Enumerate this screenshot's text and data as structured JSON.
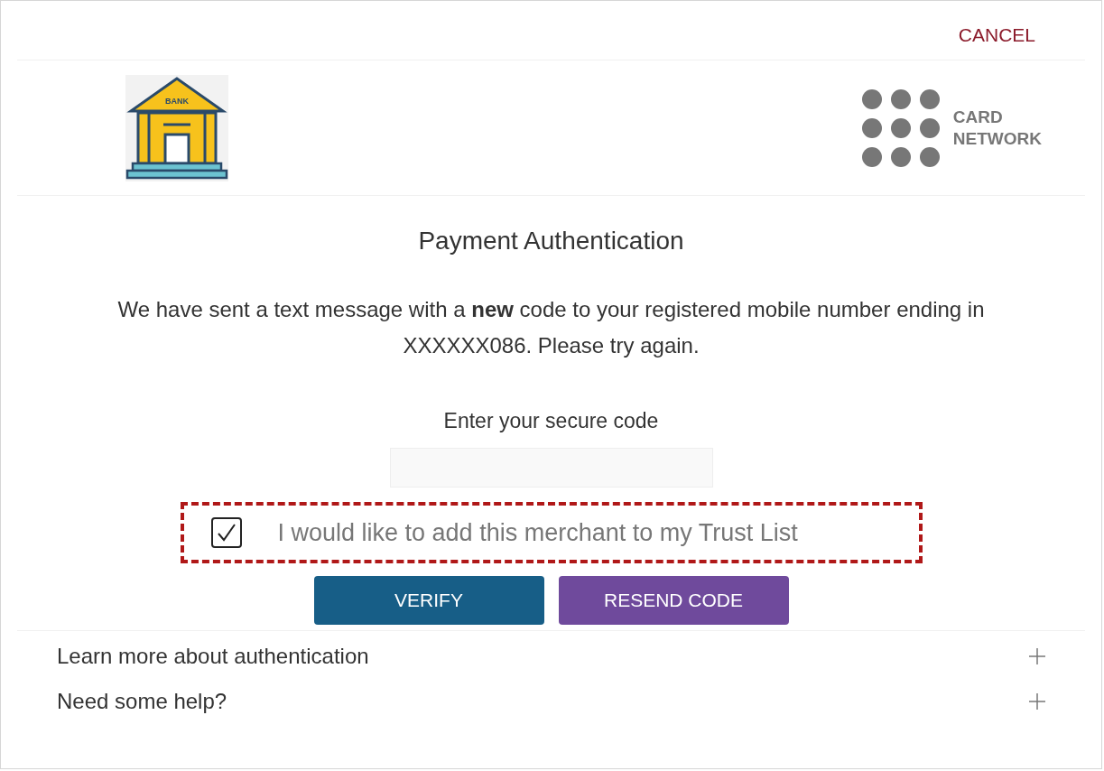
{
  "cancel": "CANCEL",
  "bank_logo": {
    "label": "BANK"
  },
  "network_logo": {
    "lines": [
      "CARD",
      "NETWORK"
    ]
  },
  "title": "Payment Authentication",
  "message": "We have sent a text message with a **new** code to your registered mobile number ending in XXXXXX086. Please try again.",
  "code_field": {
    "label": "Enter your secure code"
  },
  "trust_option": {
    "label": "I would like to add this merchant to my Trust List",
    "checked": true,
    "highlighted": true
  },
  "buttons": [
    {
      "label": "VERIFY",
      "kind": "primary"
    },
    {
      "label": "RESEND CODE",
      "kind": "secondary"
    }
  ],
  "sections": [
    {
      "label": "Learn more about authentication",
      "expanded": false
    },
    {
      "label": "Need some help?",
      "expanded": false
    }
  ]
}
